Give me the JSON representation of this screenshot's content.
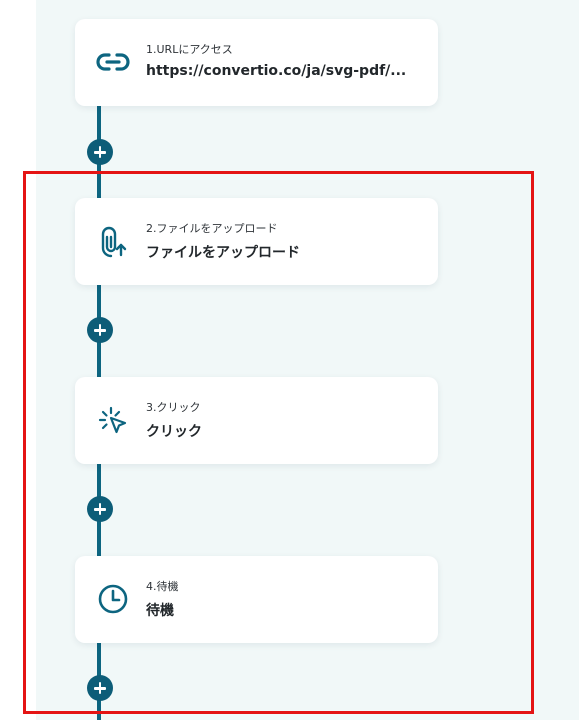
{
  "flow": {
    "steps": [
      {
        "step_label": "1.URLにアクセス",
        "title": "https://convertio.co/ja/svg-pdf/...",
        "icon": "link-icon"
      },
      {
        "step_label": "2.ファイルをアップロード",
        "title": "ファイルをアップロード",
        "icon": "paperclip-upload-icon"
      },
      {
        "step_label": "3.クリック",
        "title": "クリック",
        "icon": "cursor-click-icon"
      },
      {
        "step_label": "4.待機",
        "title": "待機",
        "icon": "clock-icon"
      }
    ],
    "add_button_icon": "plus-icon"
  },
  "colors": {
    "accent": "#0d6580",
    "canvas_background": "#f1f8f8",
    "card_background": "#ffffff",
    "highlight": "#e41414"
  }
}
